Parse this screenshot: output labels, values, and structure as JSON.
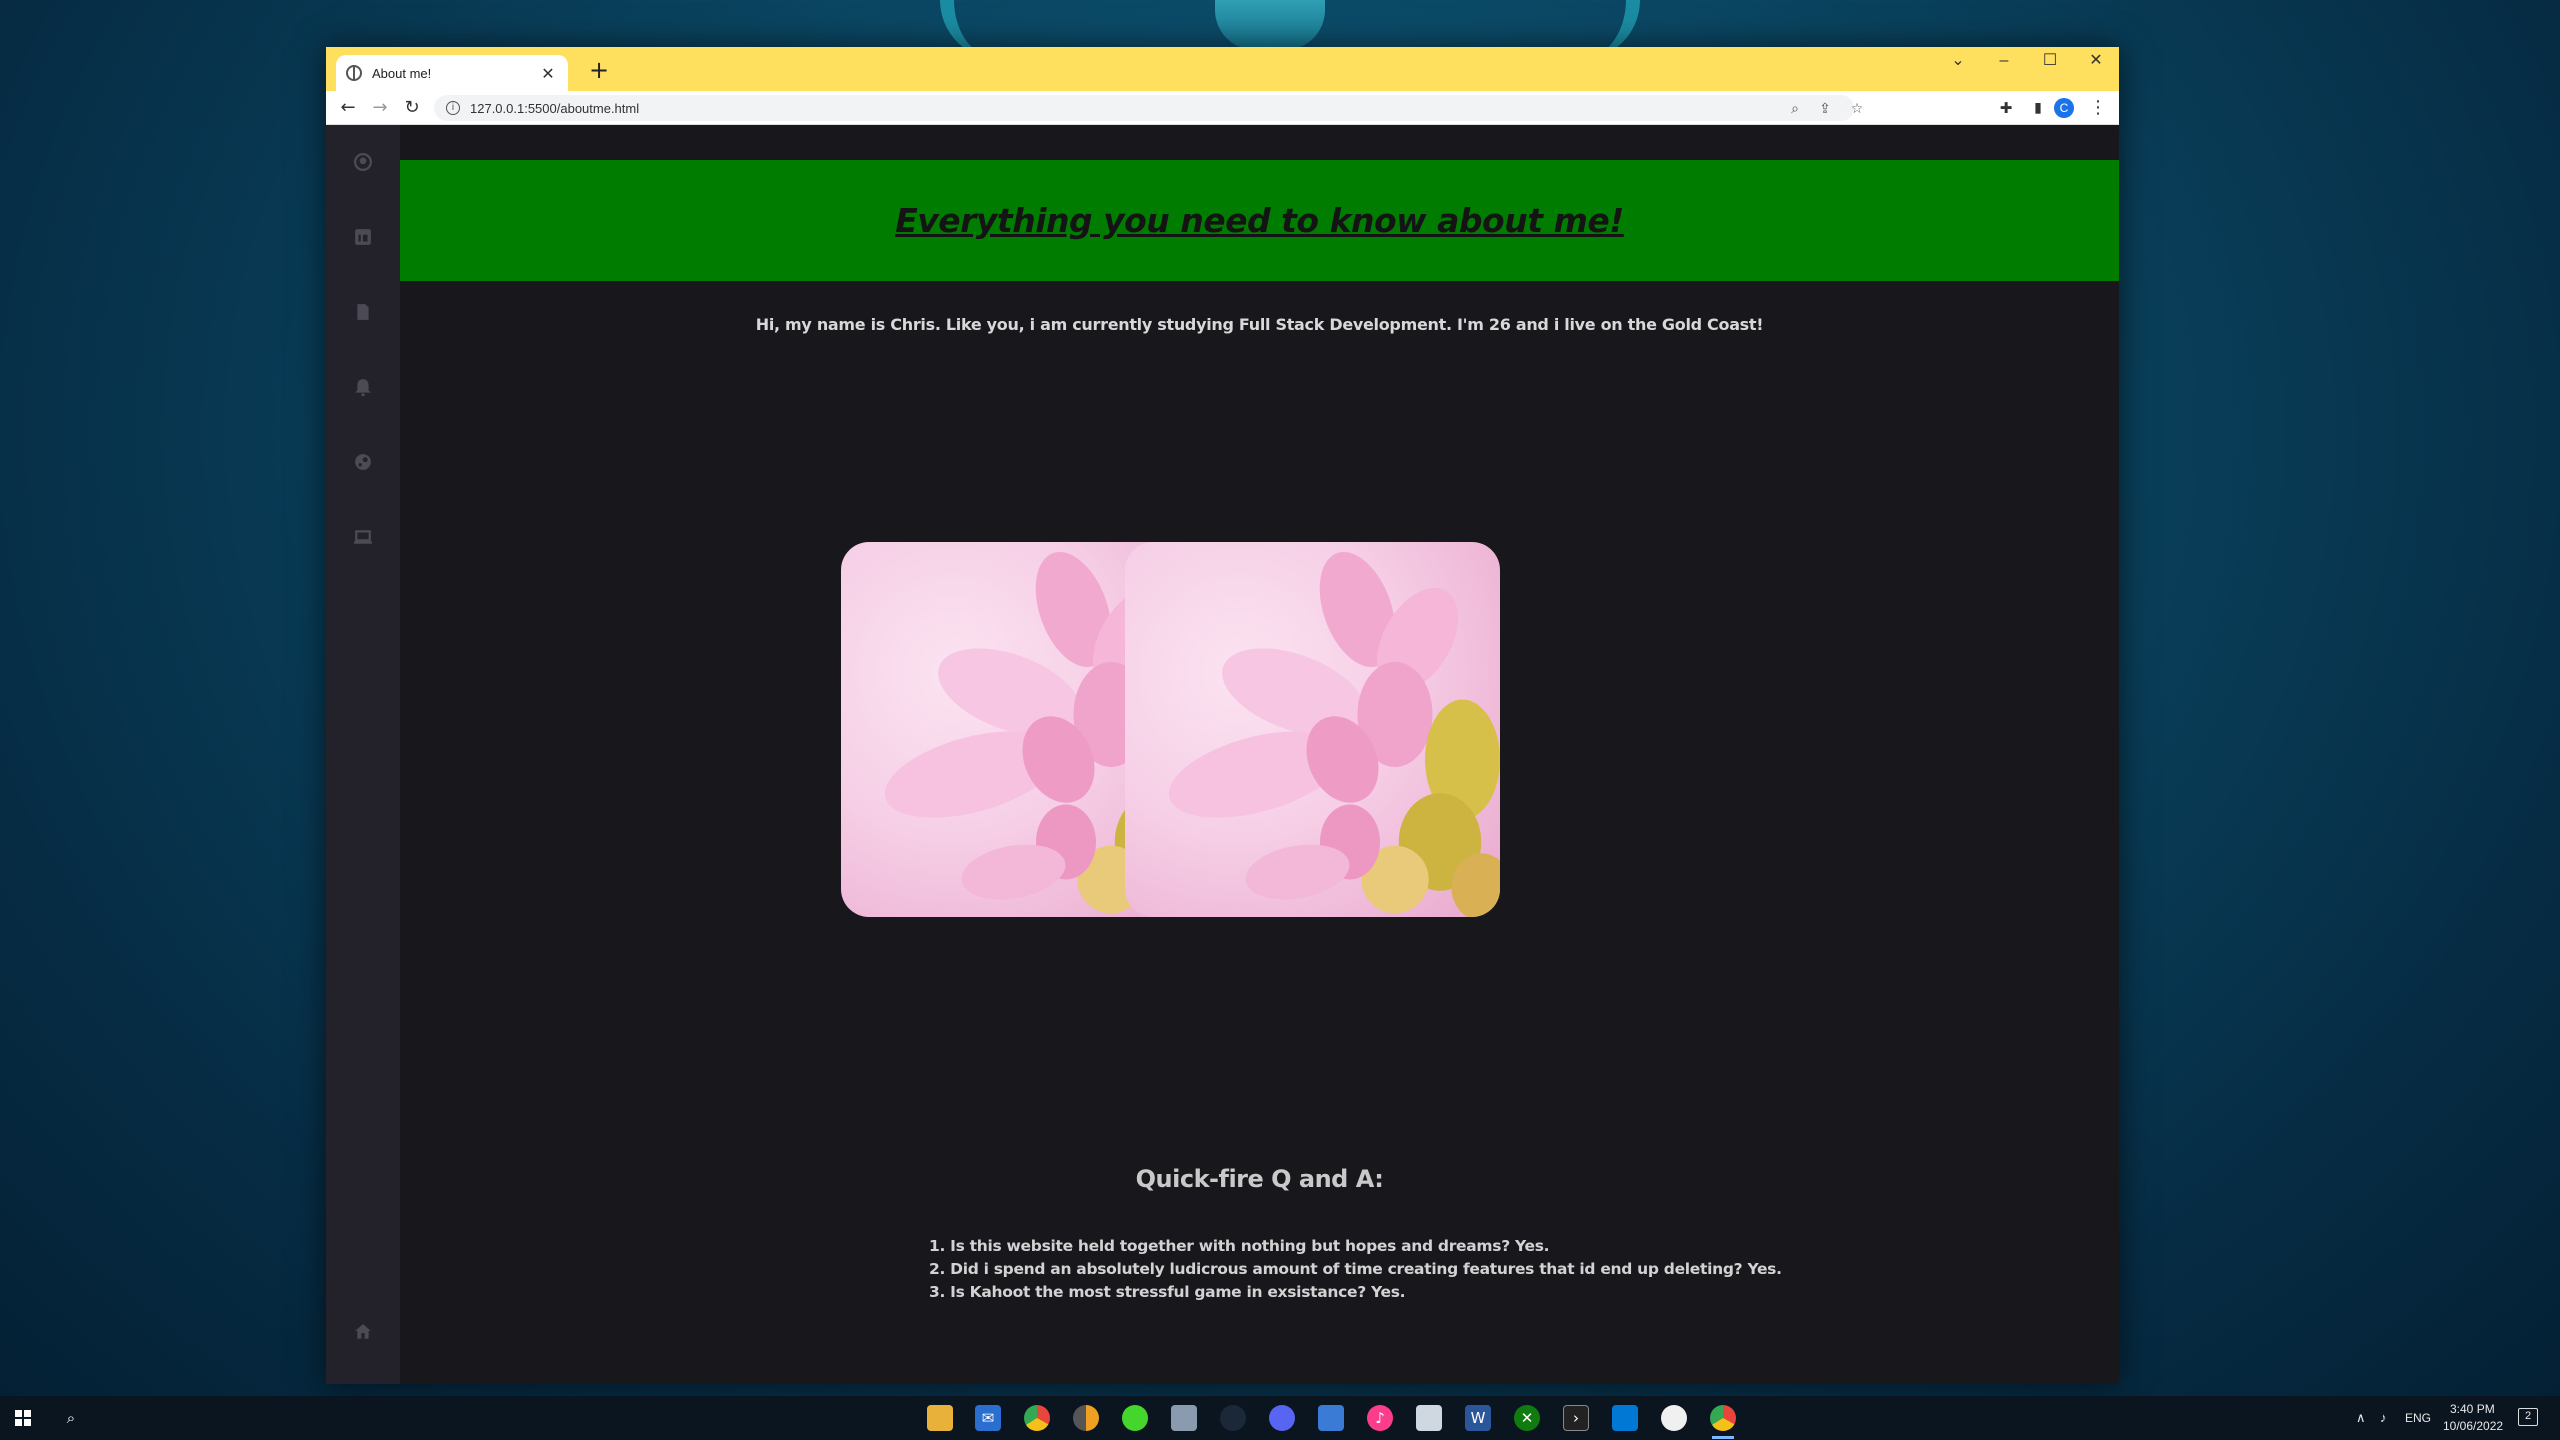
{
  "browser": {
    "tab_title": "About me!",
    "tab_close": "✕",
    "new_tab": "+",
    "url": "127.0.0.1:5500/aboutme.html",
    "profile_initial": "C",
    "window_controls": {
      "dropdown": "⌄",
      "minimize": "–",
      "maximize": "☐",
      "close": "✕"
    }
  },
  "sidebar": {
    "icons": [
      "github-icon",
      "linkedin-icon",
      "document-icon",
      "bell-icon",
      "steam-icon",
      "laptop-icon"
    ],
    "bottom_icon": "home-icon"
  },
  "page": {
    "banner_title": "Everything you need to know about me!",
    "intro": "Hi, my name is Chris. Like you, i am currently studying Full Stack Development. I'm 26 and i live on the Gold Coast!",
    "qa_title": "Quick-fire Q and A:",
    "qa_items": [
      "1. Is this website held together with nothing but hopes and dreams? Yes.",
      "2. Did i spend an absolutely ludicrous amount of time creating features that id end up deleting? Yes.",
      "3. Is Kahoot the most stressful game in exsistance? Yes."
    ]
  },
  "taskbar": {
    "apps": [
      "file-explorer-icon",
      "mail-icon",
      "chrome-icon",
      "chrome-canary-icon",
      "razer-icon",
      "app-icon",
      "steam-icon",
      "discord-icon",
      "app-icon",
      "itunes-icon",
      "app-icon",
      "word-icon",
      "xbox-icon",
      "terminal-icon",
      "vscode-icon",
      "app-icon",
      "chrome-active-icon"
    ],
    "lang": "ENG",
    "time": "3:40 PM",
    "date": "10/06/2022",
    "notifications": "2"
  },
  "colors": {
    "titlebar": "#ffdf5e",
    "banner": "#007d00",
    "page_bg": "#18171c",
    "sidebar_bg": "#23222b"
  }
}
